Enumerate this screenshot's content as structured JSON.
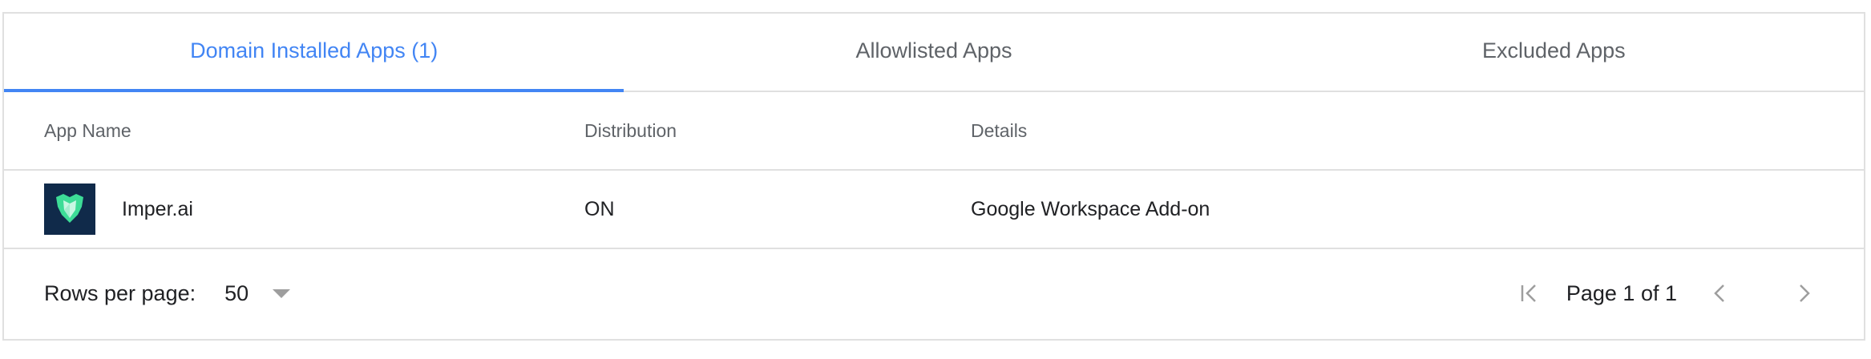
{
  "tabs": [
    {
      "label": "Domain Installed Apps (1)",
      "active": true
    },
    {
      "label": "Allowlisted Apps",
      "active": false
    },
    {
      "label": "Excluded Apps",
      "active": false
    }
  ],
  "table": {
    "columns": [
      "App Name",
      "Distribution",
      "Details"
    ],
    "rows": [
      {
        "icon": "imper-ai-logo-icon",
        "name": "Imper.ai",
        "distribution": "ON",
        "details": "Google Workspace Add-on"
      }
    ]
  },
  "footer": {
    "rows_per_page_label": "Rows per page:",
    "rows_per_page_value": "50",
    "page_label": "Page 1 of 1"
  },
  "colors": {
    "accent": "#4285f4",
    "muted_text": "#5f6368",
    "border": "#e0e0e0",
    "icon_bg": "#102a4a",
    "icon_fg": "#3ddc97"
  }
}
